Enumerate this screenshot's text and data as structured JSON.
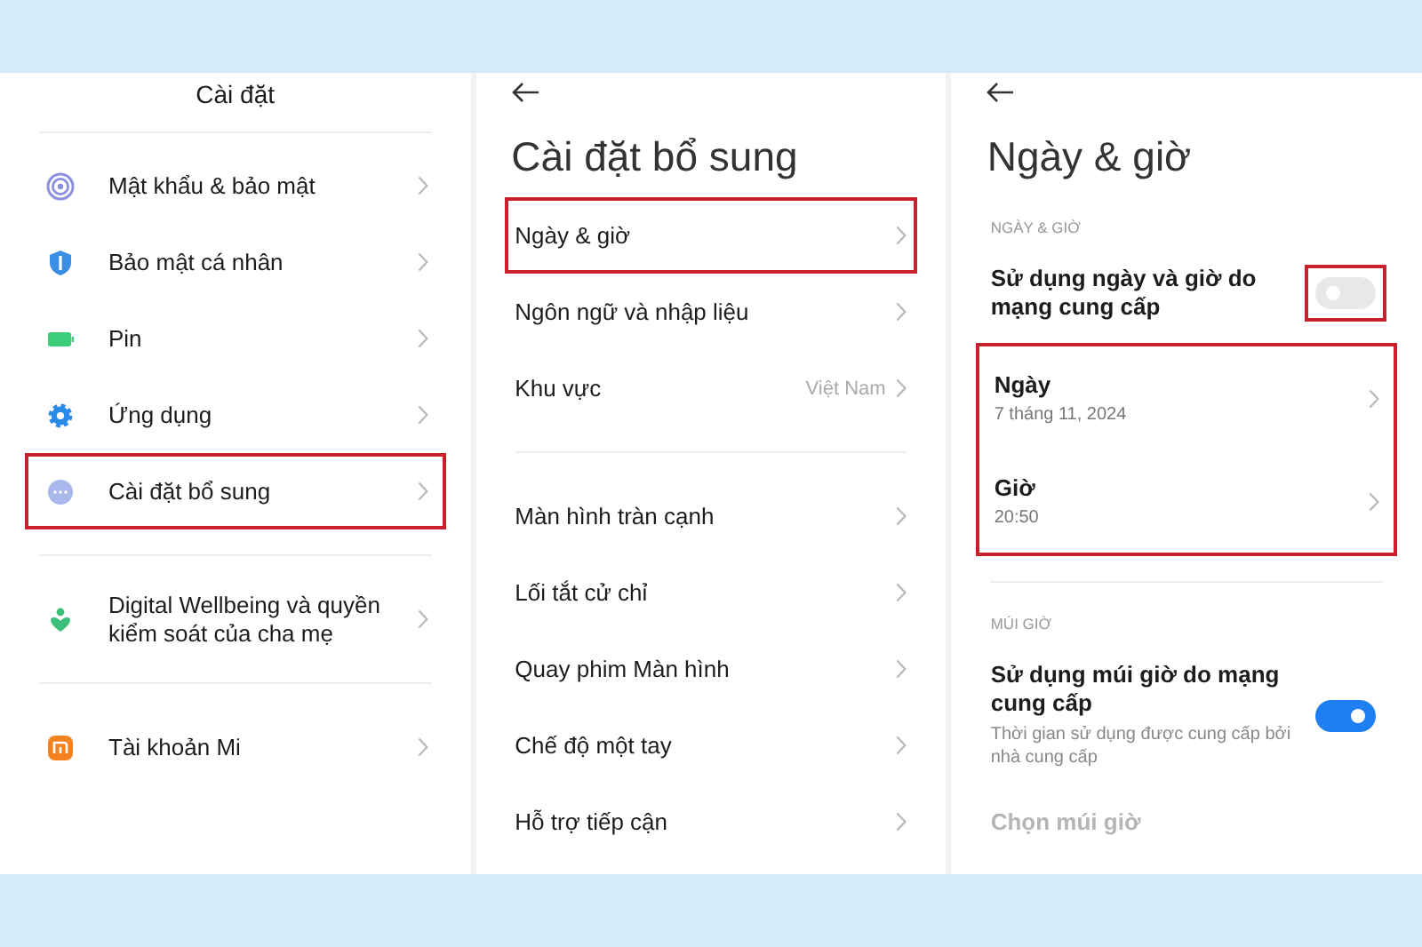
{
  "panels": [
    {
      "header": {
        "kind": "center",
        "title": "Cài đặt"
      },
      "sections": [
        {
          "items": [
            {
              "kind": "nav",
              "label": "Mật khẩu & bảo mật",
              "highlighted": false
            },
            {
              "kind": "nav",
              "label": "Bảo mật cá nhân",
              "highlighted": false
            },
            {
              "kind": "nav",
              "label": "Pin",
              "highlighted": false
            },
            {
              "kind": "nav",
              "label": "Ứng dụng",
              "highlighted": false
            },
            {
              "kind": "nav",
              "label": "Cài đặt bổ sung",
              "highlighted": true
            }
          ]
        },
        {
          "items": [
            {
              "kind": "nav",
              "label": "Digital Wellbeing và quyền kiểm soát của cha mẹ",
              "highlighted": false
            }
          ]
        },
        {
          "items": [
            {
              "kind": "nav",
              "label": "Tài khoản Mi",
              "highlighted": false
            }
          ]
        }
      ]
    },
    {
      "header": {
        "kind": "large",
        "title": "Cài đặt bổ sung"
      },
      "sections": [
        {
          "items": [
            {
              "kind": "nav",
              "label": "Ngày & giờ",
              "highlighted": true
            },
            {
              "kind": "nav",
              "label": "Ngôn ngữ và nhập liệu",
              "highlighted": false
            },
            {
              "kind": "nav",
              "label": "Khu vực",
              "value": "Việt Nam",
              "highlighted": false
            }
          ]
        },
        {
          "items": [
            {
              "kind": "nav",
              "label": "Màn hình tràn cạnh",
              "highlighted": false
            },
            {
              "kind": "nav",
              "label": "Lối tắt cử chỉ",
              "highlighted": false
            },
            {
              "kind": "nav",
              "label": "Quay phim Màn hình",
              "highlighted": false
            },
            {
              "kind": "nav",
              "label": "Chế độ một tay",
              "highlighted": false
            },
            {
              "kind": "nav",
              "label": "Hỗ trợ tiếp cận",
              "highlighted": false
            }
          ]
        }
      ]
    },
    {
      "header": {
        "kind": "large",
        "title": "Ngày & giờ"
      },
      "sections": [
        {
          "heading": "NGÀY & GIỜ",
          "items": [
            {
              "kind": "switch",
              "label": "Sử dụng ngày và giờ do mạng cung cấp",
              "on": false,
              "highlighted": true
            },
            {
              "kind": "group",
              "highlighted": true,
              "items": [
                {
                  "kind": "nav",
                  "label": "Ngày",
                  "subtitle": "7 tháng 11, 2024",
                  "highlighted": false
                },
                {
                  "kind": "nav",
                  "label": "Giờ",
                  "subtitle": "20:50",
                  "highlighted": false
                }
              ]
            }
          ]
        },
        {
          "heading": "MÚI GIỜ",
          "items": [
            {
              "kind": "switch",
              "label": "Sử dụng múi giờ do mạng cung cấp",
              "description": "Thời gian sử dụng được cung cấp bởi nhà cung cấp",
              "on": true,
              "highlighted": false
            },
            {
              "kind": "nav",
              "label": "Chọn múi giờ",
              "disabled": true,
              "highlighted": false
            }
          ]
        }
      ]
    }
  ]
}
